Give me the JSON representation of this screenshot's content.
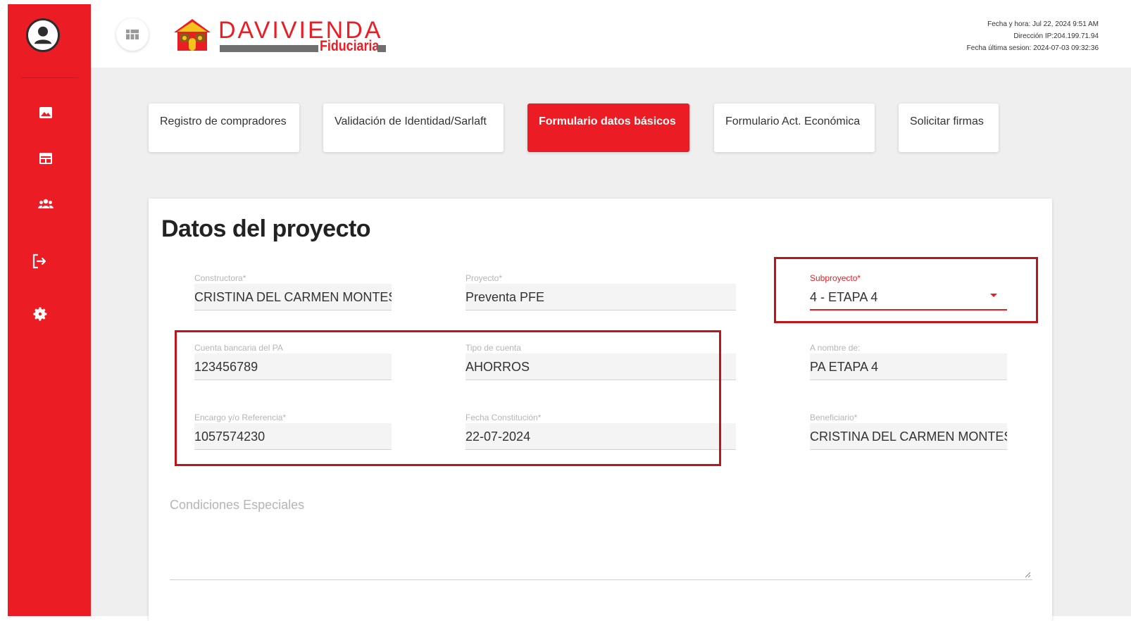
{
  "header": {
    "brand_name": "DAVIVIENDA",
    "brand_sub": "Fiduciaria",
    "meta": {
      "datetime": "Fecha y hora: Jul 22, 2024 9:51 AM",
      "ip": "Dirección IP:204.199.71.94",
      "last_session": "Fecha última sesion: 2024-07-03 09:32:36"
    }
  },
  "sidebar": {
    "icons": [
      "image-icon",
      "table-icon",
      "group-icon",
      "logout-icon",
      "gear-icon"
    ]
  },
  "tabs": [
    {
      "label": "Registro de compradores",
      "active": false
    },
    {
      "label": "Validación de Identidad/Sarlaft",
      "active": false
    },
    {
      "label": "Formulario datos básicos",
      "active": true
    },
    {
      "label": "Formulario Act. Económica",
      "active": false
    },
    {
      "label": "Solicitar firmas",
      "active": false
    }
  ],
  "form": {
    "title": "Datos del proyecto",
    "constructora": {
      "label": "Constructora*",
      "value": "CRISTINA DEL CARMEN MONTES"
    },
    "proyecto": {
      "label": "Proyecto*",
      "value": "Preventa PFE"
    },
    "subproyecto": {
      "label": "Subproyecto*",
      "value": "4 - ETAPA 4"
    },
    "cuenta": {
      "label": "Cuenta bancaria del PA",
      "value": "123456789"
    },
    "tipo_cuenta": {
      "label": "Tipo de cuenta",
      "value": "AHORROS"
    },
    "a_nombre": {
      "label": "A nombre de:",
      "value": "PA ETAPA 4"
    },
    "encargo": {
      "label": "Encargo y/o Referencia*",
      "value": "1057574230"
    },
    "fecha": {
      "label": "Fecha Constitución*",
      "value": "22-07-2024"
    },
    "beneficiario": {
      "label": "Beneficiario*",
      "value": "CRISTINA DEL CARMEN MONTES"
    },
    "condiciones": {
      "placeholder": "Condiciones Especiales",
      "value": ""
    }
  },
  "colors": {
    "brand_red": "#ec1c24",
    "highlight_red": "#c0141c",
    "background": "#efefef"
  }
}
